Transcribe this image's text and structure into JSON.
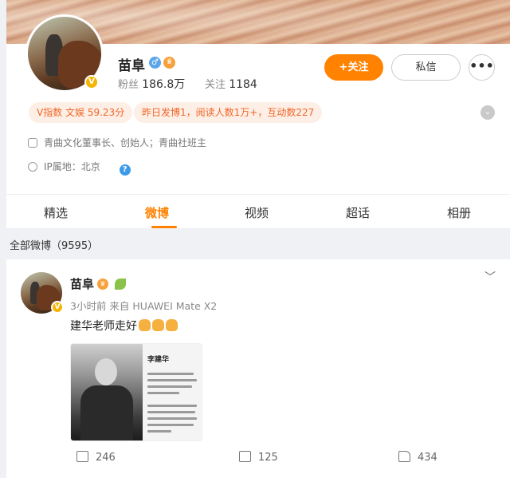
{
  "profile": {
    "name": "苗阜",
    "followers_label": "粉丝",
    "followers_count": "186.8万",
    "following_label": "关注",
    "following_count": "1184",
    "follow_button": "+关注",
    "message_button": "私信",
    "more_button": "•••",
    "vbadge": "V",
    "gender_symbol": "♂",
    "crown_symbol": "♛",
    "tags": [
      "V指数 文娱 59.23分",
      "昨日发博1，阅读人数1万+，互动数227"
    ],
    "info": [
      {
        "text": "青曲文化董事长、创始人；青曲社班主",
        "icon": "shield-icon"
      },
      {
        "text": "IP属地：北京",
        "icon": "location-icon"
      }
    ],
    "help_symbol": "?"
  },
  "tabs": [
    {
      "label": "精选"
    },
    {
      "label": "微博"
    },
    {
      "label": "视频"
    },
    {
      "label": "超话"
    },
    {
      "label": "相册"
    }
  ],
  "section": {
    "title": "全部微博（9595）"
  },
  "post": {
    "author": "苗阜",
    "meta": "3小时前  来自 HUAWEI Mate X2",
    "text": "建华老师走好",
    "emoji_name": "pray-emoji",
    "image": {
      "title": "李建华"
    },
    "actions": [
      {
        "icon": "share-icon",
        "count": "246"
      },
      {
        "icon": "comment-icon",
        "count": "125"
      },
      {
        "icon": "like-icon",
        "count": "434"
      }
    ]
  },
  "colors": {
    "accent": "#ff8200",
    "tag_bg": "#fdefe5",
    "tag_text": "#f0662a",
    "page_bg": "#f0f1f4"
  }
}
